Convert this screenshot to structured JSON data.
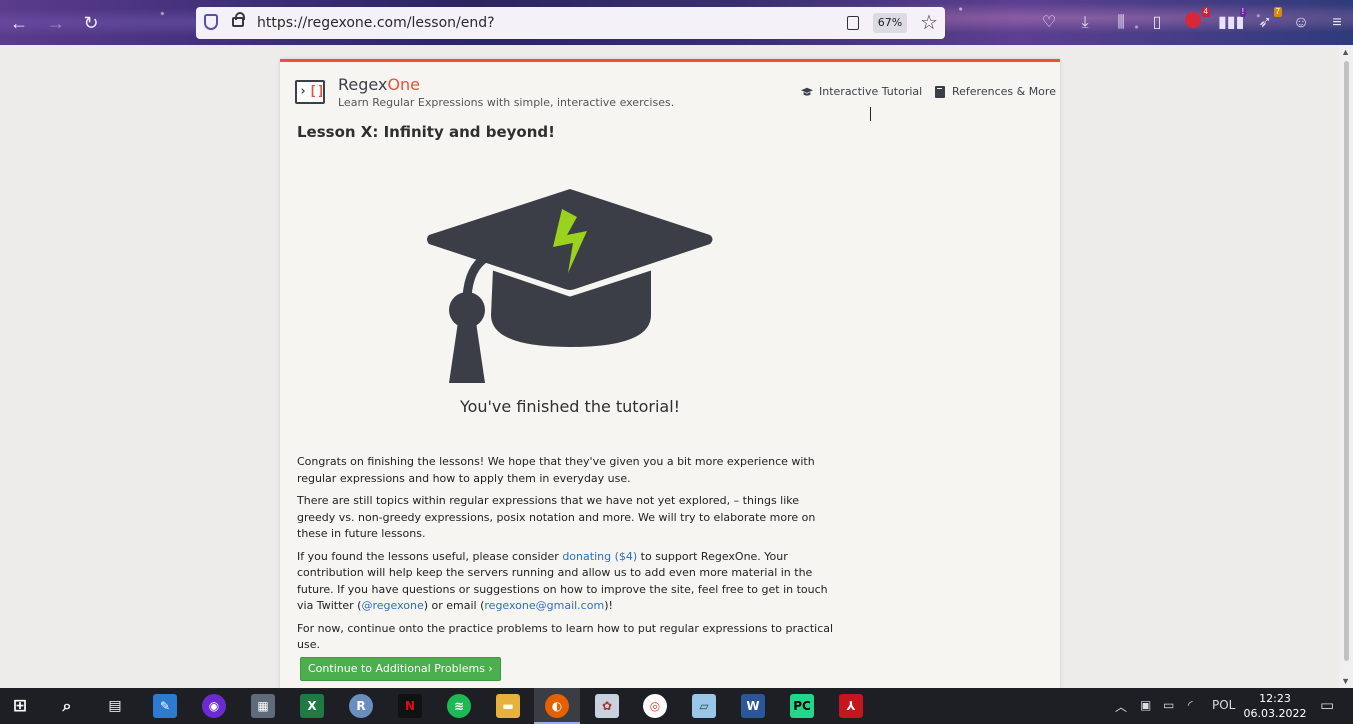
{
  "browser": {
    "url": "https://regexone.com/lesson/end?",
    "zoom": "67%",
    "badges": {
      "abp": "4",
      "ext2": "!",
      "ext3": "7"
    }
  },
  "site": {
    "brand_prefix": "Regex",
    "brand_suffix": "One",
    "tagline": "Learn Regular Expressions with simple, interactive exercises.",
    "nav": {
      "tutorial": "Interactive Tutorial",
      "references": "References & More"
    }
  },
  "lesson": {
    "title": "Lesson X: Infinity and beyond!",
    "finished_caption": "You've finished the tutorial!",
    "p1": "Congrats on finishing the lessons! We hope that they've given you a bit more experience with regular expressions and how to apply them in everyday use.",
    "p2": "There are still topics within regular expressions that we have not yet explored, – things like greedy vs. non-greedy expressions, posix notation and more. We will try to elaborate more on these in future lessons.",
    "p3_a": "If you found the lessons useful, please consider ",
    "p3_donate": "donating ($4)",
    "p3_b": " to support RegexOne. Your contribution will help keep the servers running and allow us to add even more material in the future. If you have questions or suggestions on how to improve the site, feel free to get in touch via Twitter (",
    "p3_twitter": "@regexone",
    "p3_c": ") or email (",
    "p3_email": "regexone@gmail.com",
    "p3_d": ")!",
    "p4": "For now, continue onto the practice problems to learn how to put regular expressions to practical use.",
    "cta": "Continue to Additional Problems ›"
  },
  "taskbar": {
    "language": "POL",
    "time": "12:23",
    "date": "06.03.2022"
  },
  "colors": {
    "accent": "#e5533c",
    "cta": "#4cae4c",
    "link": "#2d6fc4",
    "bolt": "#9bd21e"
  }
}
